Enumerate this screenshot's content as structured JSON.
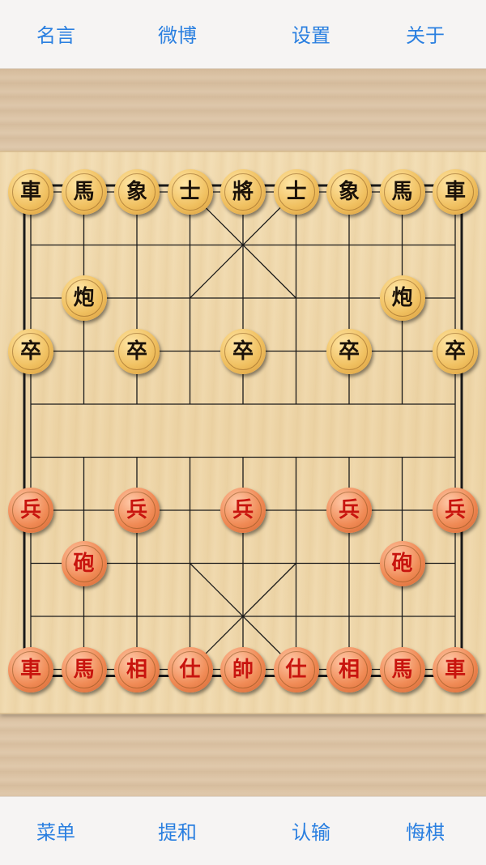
{
  "top_bar": {
    "quotes_label": "名言",
    "weibo_label": "微博",
    "settings_label": "设置",
    "about_label": "关于"
  },
  "bottom_bar": {
    "menu_label": "菜单",
    "offer_draw_label": "提和",
    "resign_label": "认输",
    "undo_label": "悔棋"
  },
  "colors": {
    "accent": "#2a7fe0",
    "black_piece_text": "#1b1209",
    "red_piece_text": "#c8140e"
  },
  "board": {
    "files": 9,
    "ranks": 10,
    "pieces": [
      {
        "side": "black",
        "char": "車",
        "file": 0,
        "rank": 0
      },
      {
        "side": "black",
        "char": "馬",
        "file": 1,
        "rank": 0
      },
      {
        "side": "black",
        "char": "象",
        "file": 2,
        "rank": 0
      },
      {
        "side": "black",
        "char": "士",
        "file": 3,
        "rank": 0
      },
      {
        "side": "black",
        "char": "將",
        "file": 4,
        "rank": 0
      },
      {
        "side": "black",
        "char": "士",
        "file": 5,
        "rank": 0
      },
      {
        "side": "black",
        "char": "象",
        "file": 6,
        "rank": 0
      },
      {
        "side": "black",
        "char": "馬",
        "file": 7,
        "rank": 0
      },
      {
        "side": "black",
        "char": "車",
        "file": 8,
        "rank": 0
      },
      {
        "side": "black",
        "char": "炮",
        "file": 1,
        "rank": 2
      },
      {
        "side": "black",
        "char": "炮",
        "file": 7,
        "rank": 2
      },
      {
        "side": "black",
        "char": "卒",
        "file": 0,
        "rank": 3
      },
      {
        "side": "black",
        "char": "卒",
        "file": 2,
        "rank": 3
      },
      {
        "side": "black",
        "char": "卒",
        "file": 4,
        "rank": 3
      },
      {
        "side": "black",
        "char": "卒",
        "file": 6,
        "rank": 3
      },
      {
        "side": "black",
        "char": "卒",
        "file": 8,
        "rank": 3
      },
      {
        "side": "red",
        "char": "兵",
        "file": 0,
        "rank": 6
      },
      {
        "side": "red",
        "char": "兵",
        "file": 2,
        "rank": 6
      },
      {
        "side": "red",
        "char": "兵",
        "file": 4,
        "rank": 6
      },
      {
        "side": "red",
        "char": "兵",
        "file": 6,
        "rank": 6
      },
      {
        "side": "red",
        "char": "兵",
        "file": 8,
        "rank": 6
      },
      {
        "side": "red",
        "char": "砲",
        "file": 1,
        "rank": 7
      },
      {
        "side": "red",
        "char": "砲",
        "file": 7,
        "rank": 7
      },
      {
        "side": "red",
        "char": "車",
        "file": 0,
        "rank": 9
      },
      {
        "side": "red",
        "char": "馬",
        "file": 1,
        "rank": 9
      },
      {
        "side": "red",
        "char": "相",
        "file": 2,
        "rank": 9
      },
      {
        "side": "red",
        "char": "仕",
        "file": 3,
        "rank": 9
      },
      {
        "side": "red",
        "char": "帥",
        "file": 4,
        "rank": 9
      },
      {
        "side": "red",
        "char": "仕",
        "file": 5,
        "rank": 9
      },
      {
        "side": "red",
        "char": "相",
        "file": 6,
        "rank": 9
      },
      {
        "side": "red",
        "char": "馬",
        "file": 7,
        "rank": 9
      },
      {
        "side": "red",
        "char": "車",
        "file": 8,
        "rank": 9
      }
    ]
  }
}
